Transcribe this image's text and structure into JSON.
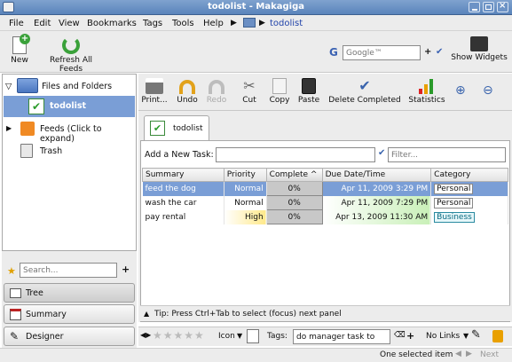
{
  "window": {
    "title": "todolist - Makagiga"
  },
  "menu": {
    "items": [
      "File",
      "Edit",
      "View",
      "Bookmarks",
      "Tags",
      "Tools",
      "Help"
    ],
    "crumb": "todolist"
  },
  "toolbar1": {
    "new_label": "New",
    "refresh_label": "Refresh All Feeds",
    "search_placeholder": "Google™",
    "widgets_label": "Show Widgets"
  },
  "tree": {
    "items": [
      {
        "label": "Files and Folders"
      },
      {
        "label": "todolist"
      },
      {
        "label": "Feeds  (Click to expand)"
      },
      {
        "label": "Trash"
      }
    ]
  },
  "sidebar": {
    "search_placeholder": "Search...",
    "tree_btn": "Tree",
    "summary_btn": "Summary",
    "designer_btn": "Designer"
  },
  "toolbar2": {
    "print": "Print...",
    "undo": "Undo",
    "redo": "Redo",
    "cut": "Cut",
    "copy": "Copy",
    "paste": "Paste",
    "delete_completed": "Delete Completed",
    "statistics": "Statistics"
  },
  "tab": {
    "label": "todolist"
  },
  "add_task": {
    "label": "Add a New Task:",
    "filter_placeholder": "Filter..."
  },
  "table": {
    "headers": [
      "Summary",
      "Priority",
      "Complete ^",
      "Due Date/Time",
      "Category"
    ],
    "rows": [
      {
        "summary": "feed the dog",
        "priority": "Normal",
        "complete": "0%",
        "due": "Apr 11, 2009 3:29 PM",
        "category": "Personal"
      },
      {
        "summary": "wash the car",
        "priority": "Normal",
        "complete": "0%",
        "due": "Apr 11, 2009 7:29 PM",
        "category": "Personal"
      },
      {
        "summary": "pay rental",
        "priority": "High",
        "complete": "0%",
        "due": "Apr 13, 2009 11:30 AM",
        "category": "Business"
      }
    ]
  },
  "tip": {
    "text": "Tip: Press Ctrl+Tab to select (focus) next panel"
  },
  "bottombar": {
    "icon_label": "Icon",
    "tags_label": "Tags:",
    "tags_value": "do manager task to",
    "links_label": "No Links"
  },
  "status": {
    "selection": "One selected item",
    "next": "Next"
  },
  "colors": {
    "selection": "#7a9ed6",
    "accent": "#5a84bb"
  }
}
